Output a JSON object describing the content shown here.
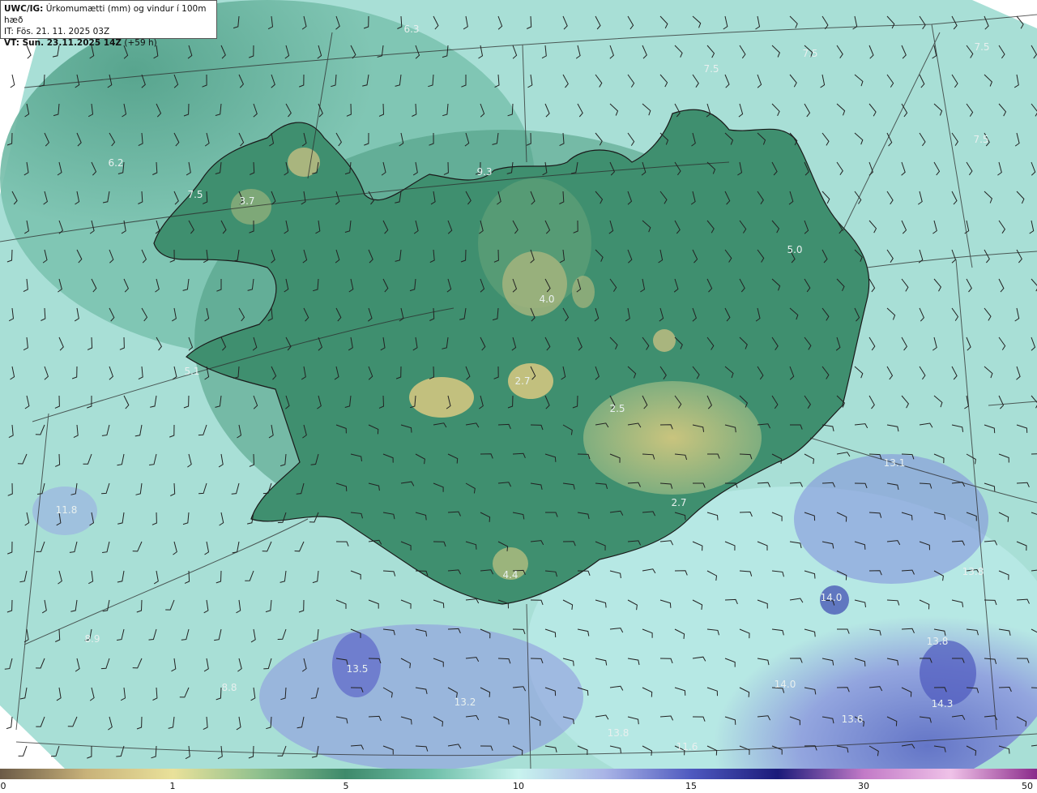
{
  "header": {
    "line1_prefix": "UWC/IG:",
    "line1_rest": " Úrkomumætti (mm) og vindur í 100m hæð",
    "line2": "IT: Fös. 21. 11. 2025 03Z",
    "line3_prefix": "VT: Sun. 23.11.2025 14Z",
    "line3_rest": " (+59 h)"
  },
  "map_values": [
    "6.3",
    "7.5",
    "7.5",
    "7.5",
    "9.3",
    "7.5",
    "6.2",
    "7.5",
    "3.7",
    "5.0",
    "4.0",
    "5.1",
    "2.7",
    "2.5",
    "2.7",
    "4.4",
    "13.1",
    "11.8",
    "14.0",
    "13.5",
    "13.2",
    "13.8",
    "14.0",
    "13.6",
    "14.3",
    "13.8",
    "13.8",
    "11.6",
    "8.9",
    "8.8"
  ],
  "colorbar": {
    "ticks": [
      "0",
      "1",
      "5",
      "10",
      "15",
      "30",
      "50"
    ],
    "colors": [
      "#6b5a46",
      "#c8b27a",
      "#e9e19a",
      "#8fc08e",
      "#3e8a6b",
      "#6fbfa9",
      "#c8f3ee",
      "#a9b4e6",
      "#4e59bf",
      "#1b1b7a",
      "#c27ac7",
      "#efc2e8",
      "#8a2a8a"
    ]
  }
}
